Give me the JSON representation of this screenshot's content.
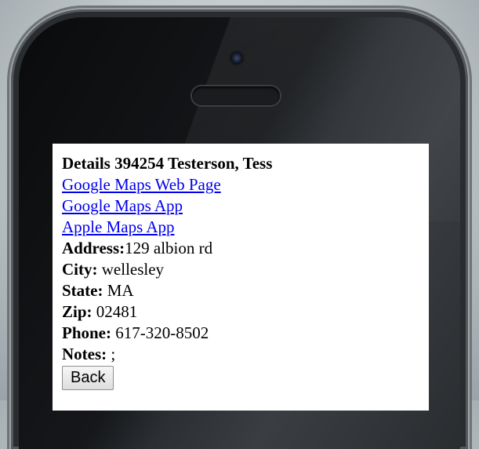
{
  "details": {
    "title": "Details 394254 Testerson, Tess",
    "links": [
      "Google Maps Web Page",
      "Google Maps App",
      "Apple Maps App"
    ],
    "address_label": "Address:",
    "address_value": "129 albion rd",
    "city_label": "City:",
    "city_value": " wellesley",
    "state_label": "State:",
    "state_value": " MA",
    "zip_label": "Zip:",
    "zip_value": " 02481",
    "phone_label": "Phone:",
    "phone_value": " 617-320-8502",
    "notes_label": "Notes:",
    "notes_value": " ;",
    "back_label": "Back"
  }
}
